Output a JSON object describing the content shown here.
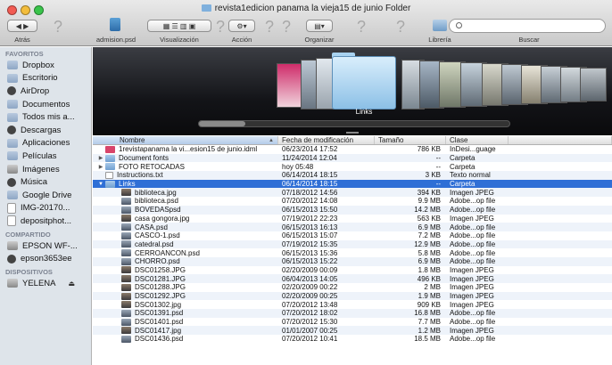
{
  "window": {
    "title": "revista1edicion panama la vieja15 de junio Folder"
  },
  "toolbar": {
    "back_label": "Atrás",
    "file_label": "admision.psd",
    "view_label": "Visualización",
    "action_label": "Acción",
    "arrange_label": "Organizar",
    "library_label": "Librería",
    "search_label": "Buscar",
    "search_placeholder": "",
    "help_glyph": "?"
  },
  "sidebar": {
    "favorites_title": "FAVORITOS",
    "favorites": [
      {
        "label": "Dropbox",
        "icon": "folder-icon"
      },
      {
        "label": "Escritorio",
        "icon": "folder-icon"
      },
      {
        "label": "AirDrop",
        "icon": "airdrop-icon"
      },
      {
        "label": "Documentos",
        "icon": "folder-icon"
      },
      {
        "label": "Todos mis a...",
        "icon": "folder-icon"
      },
      {
        "label": "Descargas",
        "icon": "download-icon"
      },
      {
        "label": "Aplicaciones",
        "icon": "apps-icon"
      },
      {
        "label": "Películas",
        "icon": "folder-icon"
      },
      {
        "label": "Imágenes",
        "icon": "camera-icon"
      },
      {
        "label": "Música",
        "icon": "music-icon"
      },
      {
        "label": "Google Drive",
        "icon": "folder-icon"
      },
      {
        "label": "IMG-20170...",
        "icon": "document-icon"
      },
      {
        "label": "depositphot...",
        "icon": "document-icon"
      }
    ],
    "shared_title": "COMPARTIDO",
    "shared": [
      {
        "label": "EPSON WF-...",
        "icon": "printer-icon"
      },
      {
        "label": "epson3653ee",
        "icon": "computer-icon"
      }
    ],
    "devices_title": "DISPOSITIVOS",
    "devices": [
      {
        "label": "YELENA",
        "icon": "drive-icon",
        "eject": "⏏"
      }
    ]
  },
  "coverflow": {
    "selected_label": "Links"
  },
  "list": {
    "columns": {
      "name": "Nombre",
      "date": "Fecha de modificación",
      "size": "Tamaño",
      "kind": "Clase"
    },
    "rows": [
      {
        "name": "1revistapanama la vi...esion15 de junio.idml",
        "date": "06/23/2014 17:52",
        "size": "786 KB",
        "kind": "InDesi...guage",
        "icon": "indd",
        "indent": 0,
        "tri": ""
      },
      {
        "name": "Document fonts",
        "date": "11/24/2014 12:04",
        "size": "--",
        "kind": "Carpeta",
        "icon": "folder",
        "indent": 0,
        "tri": "▶"
      },
      {
        "name": "FOTO RETOCADAS",
        "date": "hoy 05:48",
        "size": "--",
        "kind": "Carpeta",
        "icon": "folder",
        "indent": 0,
        "tri": "▶"
      },
      {
        "name": "Instructions.txt",
        "date": "06/14/2014 18:15",
        "size": "3 KB",
        "kind": "Texto normal",
        "icon": "doc",
        "indent": 0,
        "tri": ""
      },
      {
        "name": "Links",
        "date": "06/14/2014 18:15",
        "size": "--",
        "kind": "Carpeta",
        "icon": "folder",
        "indent": 0,
        "tri": "▼",
        "selected": true
      },
      {
        "name": "biblioteca.jpg",
        "date": "07/18/2012 14:56",
        "size": "394 KB",
        "kind": "Imagen JPEG",
        "icon": "img",
        "indent": 1
      },
      {
        "name": "biblioteca.psd",
        "date": "07/20/2012 14:08",
        "size": "9.9 MB",
        "kind": "Adobe...op file",
        "icon": "psd",
        "indent": 1
      },
      {
        "name": "BOVEDASpsd",
        "date": "06/15/2013 15:50",
        "size": "14.2 MB",
        "kind": "Adobe...op file",
        "icon": "psd",
        "indent": 1
      },
      {
        "name": "casa gongora.jpg",
        "date": "07/19/2012 22:23",
        "size": "563 KB",
        "kind": "Imagen JPEG",
        "icon": "img",
        "indent": 1
      },
      {
        "name": "CASA.psd",
        "date": "06/15/2013 16:13",
        "size": "6.9 MB",
        "kind": "Adobe...op file",
        "icon": "psd",
        "indent": 1
      },
      {
        "name": "CASCO-1.psd",
        "date": "06/15/2013 15:07",
        "size": "7.2 MB",
        "kind": "Adobe...op file",
        "icon": "psd",
        "indent": 1
      },
      {
        "name": "catedral.psd",
        "date": "07/19/2012 15:35",
        "size": "12.9 MB",
        "kind": "Adobe...op file",
        "icon": "psd",
        "indent": 1
      },
      {
        "name": "CERROANCON.psd",
        "date": "06/15/2013 15:36",
        "size": "5.8 MB",
        "kind": "Adobe...op file",
        "icon": "psd",
        "indent": 1
      },
      {
        "name": "CHORRO.psd",
        "date": "06/15/2013 15:22",
        "size": "6.9 MB",
        "kind": "Adobe...op file",
        "icon": "psd",
        "indent": 1
      },
      {
        "name": "DSC01258.JPG",
        "date": "02/20/2009 00:09",
        "size": "1.8 MB",
        "kind": "Imagen JPEG",
        "icon": "img",
        "indent": 1
      },
      {
        "name": "DSC01281.JPG",
        "date": "06/04/2013 14:05",
        "size": "496 KB",
        "kind": "Imagen JPEG",
        "icon": "img",
        "indent": 1
      },
      {
        "name": "DSC01288.JPG",
        "date": "02/20/2009 00:22",
        "size": "2 MB",
        "kind": "Imagen JPEG",
        "icon": "img",
        "indent": 1
      },
      {
        "name": "DSC01292.JPG",
        "date": "02/20/2009 00:25",
        "size": "1.9 MB",
        "kind": "Imagen JPEG",
        "icon": "img",
        "indent": 1
      },
      {
        "name": "DSC01302.jpg",
        "date": "07/20/2012 13:48",
        "size": "909 KB",
        "kind": "Imagen JPEG",
        "icon": "img",
        "indent": 1
      },
      {
        "name": "DSC01391.psd",
        "date": "07/20/2012 18:02",
        "size": "16.8 MB",
        "kind": "Adobe...op file",
        "icon": "psd",
        "indent": 1
      },
      {
        "name": "DSC01401.psd",
        "date": "07/20/2012 15:30",
        "size": "7.7 MB",
        "kind": "Adobe...op file",
        "icon": "psd",
        "indent": 1
      },
      {
        "name": "DSC01417.jpg",
        "date": "01/01/2007 00:25",
        "size": "1.2 MB",
        "kind": "Imagen JPEG",
        "icon": "img",
        "indent": 1
      },
      {
        "name": "DSC01436.psd",
        "date": "07/20/2012 10:41",
        "size": "18.5 MB",
        "kind": "Adobe...op file",
        "icon": "psd",
        "indent": 1
      }
    ]
  },
  "colors": {
    "selection": "#2f6fd6",
    "sidebar": "#dee4ea",
    "coverflow": "#131418"
  }
}
